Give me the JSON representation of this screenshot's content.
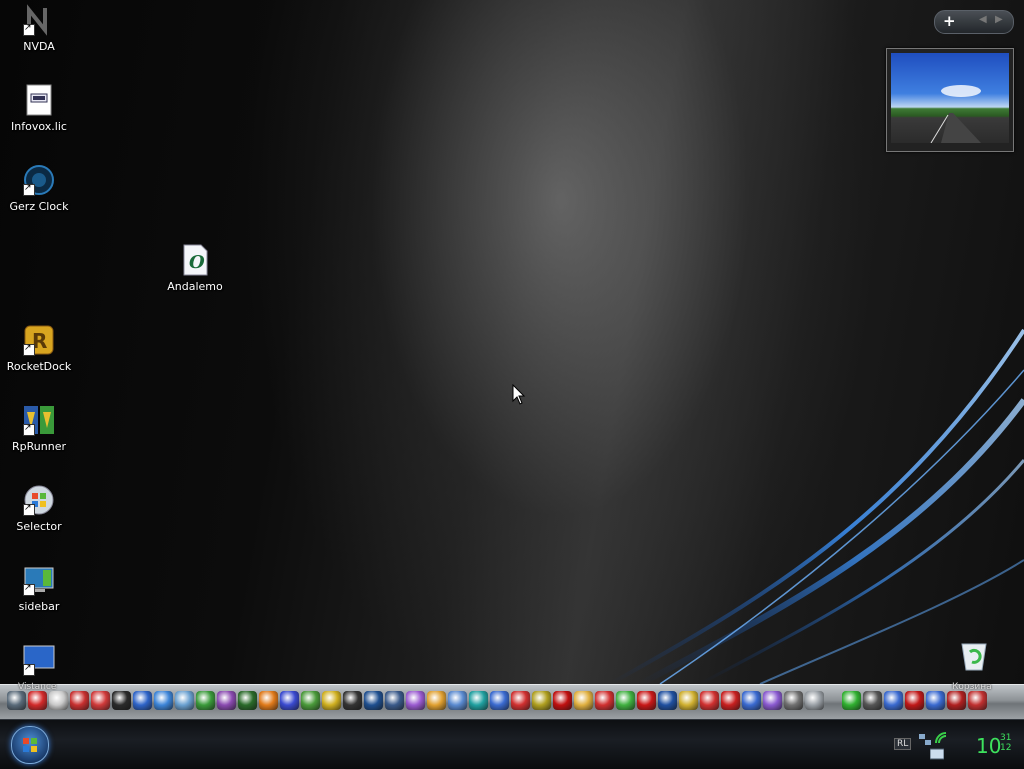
{
  "desktop": {
    "icons": [
      {
        "label": "NVDA",
        "icon": "nvda-icon",
        "shortcut": true
      },
      {
        "label": "Infovox.lic",
        "icon": "license-file-icon",
        "shortcut": false
      },
      {
        "label": "Gerz Clock",
        "icon": "clock-icon",
        "shortcut": true
      },
      {
        "label": "Andalemo",
        "icon": "opera-document-icon",
        "shortcut": false
      },
      {
        "label": "RocketDock",
        "icon": "rocketdock-icon",
        "shortcut": true
      },
      {
        "label": "RpRunner",
        "icon": "rprunner-icon",
        "shortcut": true
      },
      {
        "label": "Selector",
        "icon": "windows-orb-icon",
        "shortcut": true
      },
      {
        "label": "sidebar",
        "icon": "sidebar-icon",
        "shortcut": true
      },
      {
        "label": "",
        "icon": "monitor-icon",
        "shortcut": true
      }
    ],
    "recycle_bin": {
      "label": "Корзина",
      "icon": "recycle-bin-icon"
    }
  },
  "sidebar": {
    "controls": {
      "add": "+",
      "prev": "◀",
      "next": "▶"
    },
    "slideshow": {
      "icon": "slideshow-photo"
    }
  },
  "dock": {
    "left_caption": "Vistance",
    "items": [
      "#5a6b7a",
      "#d22a2a",
      "#c9c9c9",
      "#c83030",
      "#d03a3a",
      "#2a2a2a",
      "#2e64c8",
      "#3d85d8",
      "#6aa0d0",
      "#3a9a3a",
      "#8a4ab0",
      "#2a6a2a",
      "#e07a1a",
      "#3a4ad0",
      "#4a9a3a",
      "#d0b020",
      "#333333",
      "#1f4f8f",
      "#3a5a8a",
      "#9a5ad0",
      "#e0a030",
      "#5a8ad0",
      "#20a0a0",
      "#3a6ad0",
      "#d03030",
      "#b0a020",
      "#c01010",
      "#e0b040",
      "#d03030",
      "#40b040",
      "#c81818",
      "#2050a0",
      "#d0b030",
      "#d03030",
      "#c82020",
      "#3a6ad0",
      "#8a5ad0",
      "#707070",
      "#9aa0a6",
      "sep",
      "#30b030",
      "#555555",
      "#3a6ad0",
      "#c01818",
      "#3a6ad0",
      "#b02020",
      "#c03030"
    ],
    "right_caption": "Корзина"
  },
  "taskbar": {
    "start_icon": "windows-start-orb",
    "language": "RL",
    "tray_icons": [
      "network-icon",
      "signal-icon",
      "keyboard-icon"
    ],
    "clock": {
      "hour": "10",
      "minute": "31",
      "second": "12"
    }
  }
}
